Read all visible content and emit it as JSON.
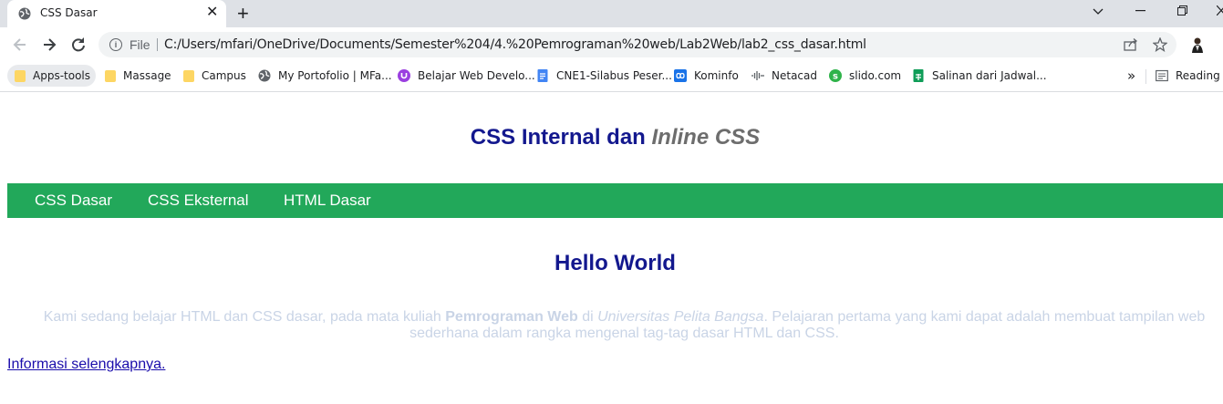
{
  "browser": {
    "tab": {
      "title": "CSS Dasar",
      "favicon": "globe-icon",
      "close_glyph": "✕"
    },
    "new_tab_glyph": "+",
    "address": {
      "scheme_label": "File",
      "url": "C:/Users/mfari/OneDrive/Documents/Semester%204/4.%20Pemrograman%20web/Lab2Web/lab2_css_dasar.html"
    },
    "bookmarks": [
      {
        "label": "Apps-tools",
        "icon": "folder-icon"
      },
      {
        "label": "Massage",
        "icon": "folder-icon"
      },
      {
        "label": "Campus",
        "icon": "folder-icon"
      },
      {
        "label": "My Portofolio | MFa...",
        "icon": "globe-icon"
      },
      {
        "label": "Belajar Web Develo...",
        "icon": "purple-u-icon"
      },
      {
        "label": "CNE1-Silabus Peser...",
        "icon": "docs-icon"
      },
      {
        "label": "Kominfo",
        "icon": "infinity-icon"
      },
      {
        "label": "Netacad",
        "icon": "cisco-icon"
      },
      {
        "label": "slido.com",
        "icon": "slido-icon"
      },
      {
        "label": "Salinan dari Jadwal...",
        "icon": "sheets-icon"
      }
    ],
    "overflow_glyph": "»",
    "reading_list": "Reading li"
  },
  "page": {
    "header_main": "CSS Internal dan ",
    "header_em": "Inline CSS",
    "nav": [
      "CSS Dasar",
      "CSS Eksternal",
      "HTML Dasar"
    ],
    "hello": "Hello World",
    "para_1": "Kami sedang belajar HTML dan CSS dasar, pada mata kuliah ",
    "para_bold": "Pemrograman Web",
    "para_2": " di ",
    "para_em": "Universitas Pelita Bangsa",
    "para_3": ". Pelajaran pertama yang kami dapat adalah membuat tampilan web sederhana dalam rangka mengenal tag-tag dasar HTML dan CSS.",
    "more_link": "Informasi selengkapnya."
  },
  "colors": {
    "heading": "#13188e",
    "nav_bg": "#22a85a",
    "muted_text": "#c9d4e6",
    "link": "#1a0dab"
  }
}
